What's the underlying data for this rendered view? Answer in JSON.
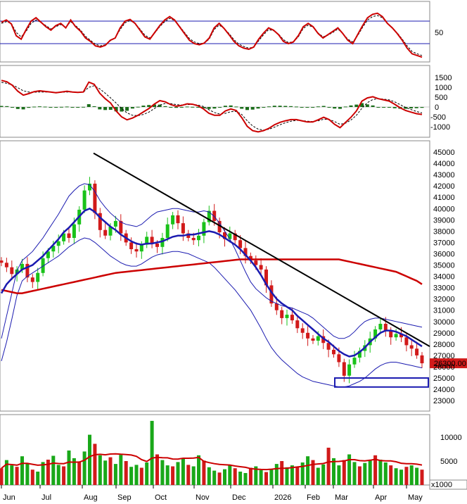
{
  "chart_data": [
    {
      "panel": "rsi",
      "type": "line",
      "y_ticks": [
        "50"
      ],
      "levels": [
        70,
        30
      ],
      "series": [
        {
          "color": "#cc0000",
          "values": [
            68,
            72,
            65,
            44,
            38,
            55,
            70,
            76,
            68,
            60,
            54,
            62,
            66,
            58,
            72,
            60,
            52,
            40,
            34,
            26,
            24,
            27,
            36,
            40,
            58,
            70,
            73,
            66,
            54,
            42,
            38,
            50,
            62,
            72,
            78,
            72,
            60,
            48,
            36,
            30,
            28,
            31,
            40,
            58,
            66,
            57,
            46,
            34,
            26,
            22,
            20,
            24,
            38,
            49,
            58,
            54,
            46,
            34,
            30,
            33,
            44,
            60,
            66,
            60,
            48,
            40,
            46,
            52,
            58,
            48,
            36,
            30,
            46,
            62,
            76,
            82,
            84,
            78,
            66,
            58,
            48,
            36,
            22,
            12,
            9,
            6
          ]
        },
        {
          "color": "#000000",
          "dashed": true,
          "values": [
            66,
            69,
            66,
            50,
            42,
            52,
            66,
            72,
            68,
            62,
            56,
            60,
            64,
            59,
            69,
            62,
            54,
            43,
            36,
            29,
            26,
            28,
            35,
            40,
            55,
            67,
            71,
            66,
            56,
            45,
            40,
            49,
            60,
            69,
            75,
            71,
            61,
            50,
            39,
            33,
            30,
            31,
            38,
            55,
            63,
            57,
            48,
            37,
            29,
            25,
            22,
            24,
            35,
            46,
            55,
            53,
            47,
            37,
            32,
            33,
            42,
            57,
            63,
            59,
            49,
            42,
            45,
            50,
            56,
            48,
            38,
            33,
            44,
            59,
            72,
            78,
            80,
            76,
            66,
            58,
            49,
            38,
            26,
            16,
            12,
            9
          ]
        }
      ]
    },
    {
      "panel": "macd",
      "type": "bar",
      "y_ticks": [
        "1500",
        "1000",
        "500",
        "0",
        "-500",
        "-1000"
      ],
      "series": [
        {
          "name": "",
          "color": "#cc0000",
          "values": [
            1350,
            1280,
            1100,
            800,
            600,
            680,
            780,
            820,
            790,
            760,
            720,
            760,
            800,
            760,
            740,
            760,
            1260,
            1150,
            700,
            420,
            200,
            -200,
            -500,
            -650,
            -560,
            -420,
            -250,
            -80,
            150,
            320,
            260,
            120,
            40,
            80,
            160,
            140,
            60,
            -100,
            -320,
            -420,
            -420,
            -200,
            -100,
            -180,
            -540,
            -980,
            -1200,
            -1260,
            -1200,
            -1080,
            -900,
            -780,
            -700,
            -640,
            -640,
            -700,
            -760,
            -760,
            -650,
            -520,
            -640,
            -880,
            -1050,
            -780,
            -520,
            -200,
            300,
            460,
            520,
            420,
            360,
            300,
            140,
            -40,
            -180,
            -260,
            -340,
            -380
          ]
        },
        {
          "name": "",
          "color": "#000000",
          "dashed": true,
          "values": [
            1250,
            1200,
            1120,
            980,
            820,
            760,
            750,
            760,
            760,
            760,
            740,
            745,
            760,
            760,
            750,
            750,
            1000,
            1080,
            920,
            700,
            460,
            200,
            -80,
            -300,
            -420,
            -440,
            -380,
            -260,
            -80,
            100,
            180,
            170,
            120,
            100,
            120,
            130,
            100,
            20,
            -140,
            -280,
            -360,
            -320,
            -240,
            -220,
            -380,
            -700,
            -960,
            -1120,
            -1170,
            -1130,
            -1020,
            -900,
            -800,
            -720,
            -680,
            -690,
            -720,
            -740,
            -700,
            -620,
            -630,
            -740,
            -880,
            -820,
            -660,
            -420,
            -60,
            220,
            380,
            420,
            400,
            360,
            260,
            120,
            -20,
            -130,
            -230,
            -300
          ]
        }
      ]
    },
    {
      "panel": "price",
      "type": "candlestick",
      "current_price": "26300.00",
      "y_ticks": [
        "45000",
        "44000",
        "43000",
        "42000",
        "41000",
        "40000",
        "39000",
        "38000",
        "37000",
        "36000",
        "35000",
        "34000",
        "33000",
        "32000",
        "31000",
        "30000",
        "29000",
        "28000",
        "27000",
        "26000",
        "25000",
        "24000",
        "23000"
      ],
      "x_ticks": [
        "Jun",
        "Jul",
        "Aug",
        "Sep",
        "Oct",
        "Nov",
        "Dec",
        "2026",
        "Feb",
        "Mar",
        "Apr",
        "May"
      ],
      "close": [
        35200,
        34800,
        34200,
        34600,
        35100,
        33900,
        33500,
        34300,
        35600,
        36200,
        36700,
        37100,
        37800,
        37400,
        38600,
        39900,
        41600,
        42200,
        39600,
        38100,
        37600,
        38400,
        38900,
        37800,
        37000,
        36400,
        36200,
        36800,
        37500,
        36900,
        36600,
        37400,
        38600,
        39400,
        38700,
        37800,
        37400,
        37200,
        37600,
        38800,
        39800,
        38900,
        37900,
        37300,
        37800,
        37200,
        36500,
        35800,
        35400,
        35000,
        34600,
        33200,
        31600,
        31000,
        30300,
        30600,
        30100,
        29400,
        29000,
        28500,
        28300,
        28700,
        28100,
        27500,
        27100,
        26400,
        25200,
        26200,
        26800,
        27400,
        27900,
        28500,
        29300,
        29800,
        29200,
        28600,
        28900,
        28600,
        27900,
        27600,
        27000,
        26300
      ],
      "sma20": [
        32500,
        33300,
        33800,
        34200,
        34600,
        34800,
        35000,
        35400,
        35800,
        36300,
        36800,
        37300,
        37900,
        38300,
        38800,
        39300,
        39800,
        40000,
        39700,
        39200,
        38800,
        38400,
        38100,
        37700,
        37400,
        37100,
        36900,
        36800,
        36900,
        36900,
        37000,
        37100,
        37300,
        37500,
        37600,
        37600,
        37700,
        37700,
        37800,
        37900,
        38000,
        37900,
        37700,
        37400,
        37100,
        36800,
        36400,
        35900,
        35400,
        34800,
        34100,
        33300,
        32600,
        32000,
        31600,
        31300,
        31000,
        30500,
        30100,
        29700,
        29300,
        28900,
        28500,
        28200,
        27800,
        27400,
        27100,
        26900,
        27000,
        27300,
        27700,
        28200,
        28600,
        29000,
        29200,
        29200,
        29100,
        28900,
        28700,
        28400,
        28100,
        27800
      ],
      "bb_upper": [
        28500,
        30500,
        32500,
        34500,
        35400,
        35800,
        36200,
        36800,
        37400,
        38100,
        38800,
        39500,
        40300,
        41100,
        41600,
        42000,
        42200,
        42100,
        41500,
        40700,
        40100,
        39600,
        39200,
        38800,
        38600,
        38500,
        38400,
        38600,
        39000,
        39400,
        39700,
        39800,
        39900,
        40000,
        40000,
        39900,
        39800,
        39700,
        39700,
        39800,
        39700,
        39300,
        38700,
        38000,
        37300,
        36400,
        35400,
        34400,
        33500,
        32900,
        32500,
        32100,
        31800,
        31600,
        31400,
        31300,
        31200,
        31000,
        30800,
        30600,
        30300,
        29900,
        29500,
        29100,
        28700,
        28500,
        28500,
        28700,
        29100,
        29600,
        30000,
        30200,
        30300,
        30300,
        30200,
        30100,
        30000,
        29900,
        29800,
        29700,
        29600,
        29500
      ],
      "bb_lower": [
        26500,
        28200,
        30200,
        32300,
        33600,
        34000,
        34300,
        34600,
        34900,
        35200,
        35500,
        35800,
        36200,
        36600,
        36900,
        37200,
        37400,
        37300,
        37000,
        36600,
        36200,
        35800,
        35500,
        35200,
        35000,
        34900,
        34900,
        35100,
        35400,
        35700,
        35900,
        36000,
        36100,
        36200,
        36200,
        36100,
        36000,
        35800,
        35600,
        35400,
        35200,
        34800,
        34300,
        33800,
        33300,
        32800,
        32200,
        31600,
        31000,
        30200,
        29400,
        28500,
        27700,
        27100,
        26600,
        26200,
        25800,
        25400,
        25100,
        24900,
        24700,
        24600,
        24500,
        24400,
        24300,
        24200,
        24200,
        24300,
        24500,
        24700,
        25000,
        25400,
        25800,
        26100,
        26300,
        26400,
        26400,
        26300,
        26200,
        26100,
        26000,
        25900
      ],
      "ma200": [
        32800,
        32700,
        32600,
        32500,
        32500,
        32600,
        32700,
        32800,
        32900,
        33000,
        33100,
        33200,
        33300,
        33400,
        33500,
        33600,
        33700,
        33800,
        33900,
        34000,
        34100,
        34200,
        34300,
        34350,
        34400,
        34450,
        34500,
        34550,
        34600,
        34650,
        34700,
        34750,
        34800,
        34850,
        34900,
        34950,
        35000,
        35050,
        35100,
        35150,
        35200,
        35250,
        35300,
        35350,
        35400,
        35450,
        35500,
        35500,
        35500,
        35500,
        35500,
        35500,
        35500,
        35500,
        35500,
        35500,
        35500,
        35500,
        35500,
        35500,
        35500,
        35500,
        35500,
        35500,
        35500,
        35500,
        35400,
        35300,
        35200,
        35100,
        35000,
        34900,
        34800,
        34700,
        34600,
        34500,
        34400,
        34200,
        34000,
        33800,
        33600,
        33300
      ],
      "trendline": [
        [
          44900,
          45000
        ],
        [
          27800,
          27800
        ]
      ],
      "support_box": [
        24200,
        25000
      ]
    },
    {
      "panel": "volume",
      "type": "bar",
      "unit": "x1000",
      "y_ticks": [
        "10000",
        "5000"
      ],
      "values": [
        3500,
        5200,
        4100,
        3800,
        6000,
        4500,
        3200,
        2800,
        4800,
        5300,
        6100,
        4200,
        3900,
        7200,
        5600,
        4800,
        7000,
        10500,
        8600,
        6200,
        5100,
        5800,
        4400,
        6300,
        5000,
        3800,
        4200,
        3600,
        4700,
        13400,
        6400,
        5200,
        4100,
        3900,
        4800,
        5600,
        4200,
        3900,
        6200,
        5100,
        3700,
        3000,
        2600,
        3300,
        4200,
        3500,
        2800,
        2500,
        3600,
        3900,
        3100,
        2700,
        3400,
        4400,
        5000,
        3700,
        4100,
        3800,
        4700,
        6000,
        5200,
        3600,
        4300,
        7800,
        5600,
        4100,
        5200,
        6400,
        4800,
        3900,
        4600,
        5100,
        6200,
        5300,
        4700,
        4100,
        3500,
        3200,
        3800,
        4100,
        3600,
        3200
      ],
      "ma_color": "#cc0000"
    }
  ]
}
